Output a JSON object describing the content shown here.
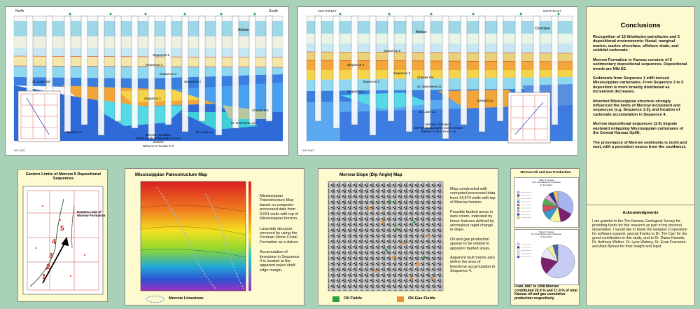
{
  "ns_section": {
    "north": "North",
    "south": "South",
    "labels": {
      "atokan": "Atokan",
      "st_louis_sm": "St. Louis SM",
      "chester_fm": "Chester Fm",
      "spergen": "Spergen Ls.",
      "st_genevieve": "St. Genevieve Ls.",
      "st_louis": "St. Louis Ls.",
      "seq1": "Sequence 1",
      "seq2": "Sequence 2",
      "seq3": "Sequence 3",
      "seq4": "Sequence 4",
      "seq5": "Sequence 5"
    },
    "title_lines": [
      "Morrow Formation",
      "North-South Stratigraphic Cross Section",
      "Nelson1 to Tucker K-2"
    ],
    "id": "WS-NS5"
  },
  "swne_section": {
    "southwest": "SOUTHWEST",
    "northeast": "NORTHEAST",
    "labels": {
      "atokan": "Atokan",
      "cherokee": "Cherokee",
      "chester_fm": "Chester Fm",
      "st_genevieve": "St. Genevieve Ls.",
      "spergen": "Spergen Ls.",
      "st_louis": "St. Louis Ls.",
      "seq1": "Sequence 1",
      "seq2": "Sequence 2",
      "seq3": "Sequence 3",
      "seq4": "Sequence 4",
      "seq5": "Sequence 5"
    },
    "title_lines": [
      "Morrow Formation",
      "SW-NE Stratigraphic Cross Section",
      "Oakson 1-18 to Huck 1-6"
    ],
    "id": "WS-SW3"
  },
  "conclusions": {
    "title": "Conclusions",
    "paragraphs": [
      "Recognition of 12 lithofacies-petrofacies and 5 depositional environments: fluvial, marginal marine, marine shoreface, offshore shale, and subtidal carbonate.",
      "Morrow  Formation in Kansas consists of 5 sedimentary depositional sequences. Depositional trends are NW-SE.",
      "Sediments from Sequence 1 infill incised Mississippian carbonates. From Sequence 2 to 5 deposition is more broadly distributed as incisement decreases.",
      "Inherited Mississippian structure strongly influenced the limits of Morrow Incisement  and sequences (e.g. Sequence 1-3), and location of carbonate accumulation in Sequence 4.",
      "Morrow depositional sequences (1-5) migrate eastward onlapping Mississippian carbonates of the Central Kansas Uplift.",
      "The provenance of Morrow sediments is north and east, with a persistent source from the southwest."
    ]
  },
  "acknowledgments": {
    "title": "Acknowledgments",
    "text": "I am grateful to the The Kansas Geological Survey for providing funds for this research as part of my doctoral dissertation. I would like to thank the Geoplus Corporation for software support, special thanks to Dr. Tim Carr for his great contribution to this study, and to Dr. Diane Kamola, Dr. Anthony Walton, Dr. Lynn Watney, Dr. Evan Franseen and Alan Byrnes for their insight and input."
  },
  "eastern_limits": {
    "title": "Eastern Limits of Morrow  5 Depositional Sequences",
    "limit_label": "Eastern Limit of Morrow Formation",
    "numbers": [
      "5",
      "4",
      "3",
      "2",
      "1"
    ]
  },
  "paleostructure": {
    "title": "Mississippian Paleostructure Map",
    "paragraphs": [
      "Mississippian Paleostructure Map based on computer-processed data from 9,091 wells with top of Mississippian horizon.",
      "Laramide structure removed by using the Permian Stone Corral Formation as a datum.",
      "Accumulation of limestone in Sequence 4 is  located at the apparent paleo  shelf-edge margin."
    ],
    "legend": "Morrow Limestone"
  },
  "slope_map": {
    "title": "Morrow Slope (Dip Angle) Map",
    "paragraphs": [
      "Map constructed with computed processed data from 14,574 wells with top of Morrow horizon.",
      "Possible faulted areas in dark colors, indicated by linear features defined by anomalous rapid change in slope.",
      "Oil and gas production appear to be related to apparent faulted areas.",
      "Apparent fault trends also define the area of limestone accumulation in Sequence 4."
    ],
    "legend": [
      {
        "label": "Oil Fields",
        "color": "#2e9e3a"
      },
      {
        "label": "Oil-Gas Fields",
        "color": "#e8903a"
      }
    ]
  },
  "production": {
    "title": "Morrow Oil and Gas Production",
    "chart1_caption": [
      "State of Kansas",
      "% of Cumulative Oil Production",
      "by Formation"
    ],
    "chart2_caption": [
      "State of Kansas",
      "% of Cumulative Gas Production",
      "by Formation"
    ],
    "chart_data": [
      {
        "type": "pie",
        "values": [
          33,
          14,
          12,
          10,
          8,
          7,
          6,
          5,
          5
        ],
        "colors": [
          "#a8b4f0",
          "#7a2070",
          "#f2f2a0",
          "#3a9ad0",
          "#d05060",
          "#50b050",
          "#e0a0d0",
          "#2040a0",
          "#f0c060"
        ]
      },
      {
        "type": "pie",
        "values": [
          62,
          17,
          10,
          6,
          5
        ],
        "colors": [
          "#c8ccf4",
          "#7a2070",
          "#e8e8f8",
          "#f2f2a0",
          "#5060b0"
        ]
      }
    ],
    "caption": "From 1987 to 1998 Morrow contributed 20.9 % and 17.4 % of total Kansas oil and gas cumulative production respectively."
  }
}
